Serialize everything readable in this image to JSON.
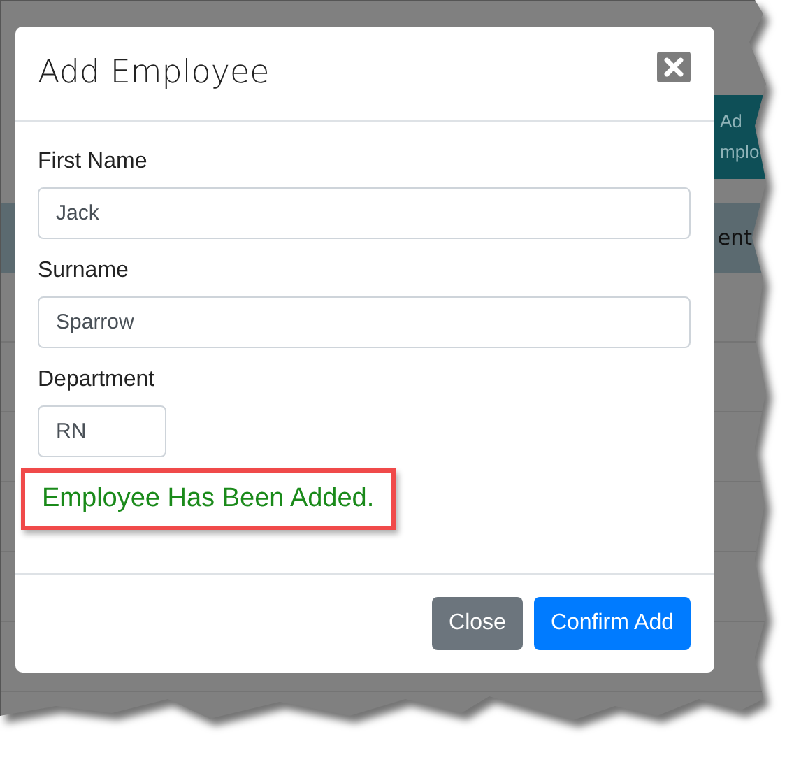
{
  "background": {
    "header_button": {
      "lines": [
        "Ad",
        "mplo"
      ]
    },
    "table_header": {
      "column_2": "ent"
    }
  },
  "modal": {
    "title": "Add Employee",
    "fields": [
      {
        "label": "First Name",
        "value": "Jack",
        "kind": "wide"
      },
      {
        "label": "Surname",
        "value": "Sparrow",
        "kind": "wide"
      },
      {
        "label": "Department",
        "value": "RN",
        "kind": "short"
      }
    ],
    "message": {
      "text": "Employee Has Been Added.",
      "highlighted": true
    },
    "buttons": [
      {
        "label": "Close",
        "kind": "secondary"
      },
      {
        "label": "Confirm Add",
        "kind": "primary"
      }
    ]
  }
}
